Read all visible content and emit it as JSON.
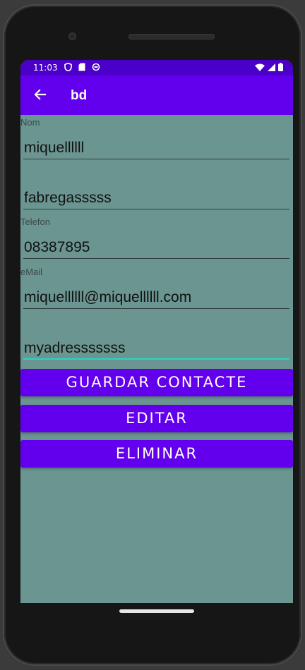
{
  "status_bar": {
    "time": "11:03"
  },
  "app_bar": {
    "title": "bd"
  },
  "form": {
    "name_label": "Nom",
    "name_value": "miquellllll",
    "surname_value": "fabregasssss",
    "phone_label": "Telefon",
    "phone_value": "08387895",
    "email_label": "eMail",
    "email_value": "miquellllll@miquellllll.com",
    "address_value": "myadresssssss"
  },
  "buttons": {
    "save": "GUARDAR CONTACTE",
    "edit": "EDITAR",
    "delete": "ELIMINAR"
  },
  "colors": {
    "primary": "#6200ee",
    "status_bar": "#4a00c8",
    "background": "#6b9590",
    "focus_accent": "#2ad4c4"
  }
}
